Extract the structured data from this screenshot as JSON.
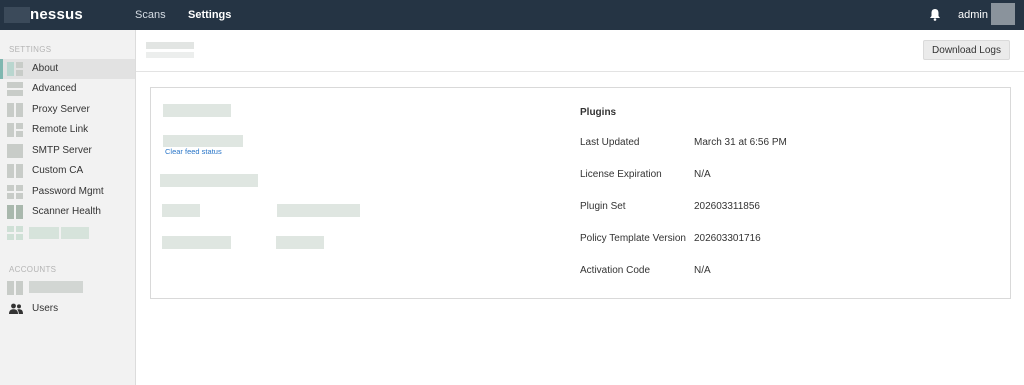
{
  "topbar": {
    "brand": "nessus",
    "nav": {
      "scans": "Scans",
      "settings": "Settings"
    },
    "user": "admin",
    "icons": {
      "bell": "bell-icon",
      "avatar": "user-avatar"
    }
  },
  "sidebar": {
    "settings_heading": "SETTINGS",
    "items": [
      {
        "label": "About",
        "active": true
      },
      {
        "label": "Advanced"
      },
      {
        "label": "Proxy Server"
      },
      {
        "label": "Remote Link"
      },
      {
        "label": "SMTP Server"
      },
      {
        "label": "Custom CA"
      },
      {
        "label": "Password Mgmt"
      },
      {
        "label": "Scanner Health"
      }
    ],
    "accounts_heading": "ACCOUNTS",
    "accounts_items": [
      {
        "label": "Users",
        "icon": "users-icon"
      }
    ]
  },
  "header": {
    "download_logs": "Download Logs"
  },
  "about": {
    "clear_feed_link": "Clear feed status",
    "plugins": {
      "title": "Plugins",
      "rows": [
        {
          "label": "Last Updated",
          "value": "March 31 at 6:56 PM"
        },
        {
          "label": "License Expiration",
          "value": "N/A"
        },
        {
          "label": "Plugin Set",
          "value": "202603311856"
        },
        {
          "label": "Policy Template Version",
          "value": "202603301716"
        },
        {
          "label": "Activation Code",
          "value": "N/A"
        }
      ]
    }
  },
  "colors": {
    "topbar": "#253444",
    "sidebar": "#f2f2f2",
    "active_item": "#e2e2e2",
    "link": "#2a76c8"
  }
}
